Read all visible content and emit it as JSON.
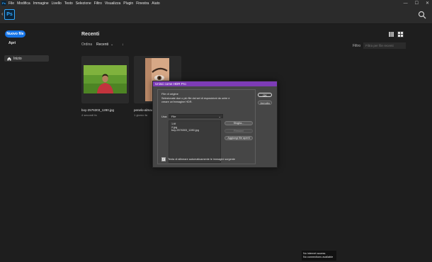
{
  "menubar": {
    "app_icon": "Ps",
    "items": [
      "File",
      "Modifica",
      "Immagine",
      "Livello",
      "Testo",
      "Selezione",
      "Filtro",
      "Visualizza",
      "Plugin",
      "Finestra",
      "Aiuto"
    ],
    "window_controls": [
      "—",
      "☐",
      "✕"
    ]
  },
  "topbar": {
    "logo": "Ps",
    "back_icon": "chevron-left-icon",
    "search_icon": "search-icon"
  },
  "sidebar": {
    "new_file": "Nuovo file",
    "open": "Apri",
    "home": "Inizio"
  },
  "main": {
    "title": "Recenti",
    "sort_label": "Ordina",
    "sort_value": "Recenti",
    "sort_direction": "↓",
    "filter_label": "Filtro",
    "filter_placeholder": "Filtra per file recenti",
    "files": [
      {
        "name": "boy-2576303_1280.jpg",
        "age": "4 secondi fa"
      },
      {
        "name": "penelo-almada",
        "age": "1 giorno fa"
      }
    ]
  },
  "dialog": {
    "title": "Unisci come HDR Pro",
    "group_label": "File di origine",
    "description": "Selezionate due o più file dal set di esposizioni da unire e creare un'immagine HDR.",
    "use_label": "Usa:",
    "use_value": "File",
    "file_list": [
      "1.tif",
      "2.jpg",
      "boy-2576303_1280.jpg"
    ],
    "browse": "Sfoglia...",
    "remove": "Rimuovi",
    "add_open": "Aggiungi file aperti",
    "align_label": "Tenta di allineare automaticamente le immagini sorgente",
    "align_checked": true,
    "ok": "OK",
    "cancel": "Annulla"
  },
  "toast": {
    "line1": "No internet access",
    "line2": "No connections available"
  },
  "colors": {
    "accent": "#1473e6",
    "dialog_title": "#7d3cb6",
    "ps_blue": "#31a8ff"
  }
}
